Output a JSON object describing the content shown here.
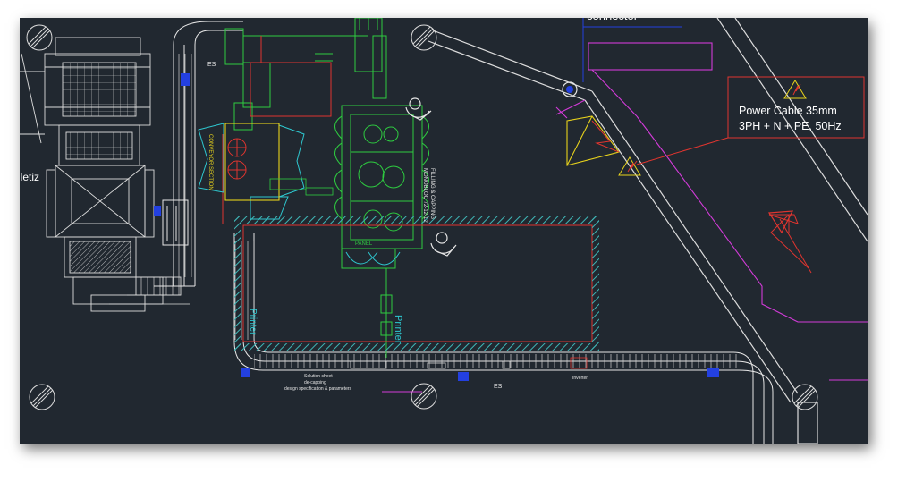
{
  "window": {
    "background": "#212830",
    "frame_shadow": true
  },
  "labels": {
    "power_cable_line1": "Power Cable 35mm",
    "power_cable_line2": "3PH + N + PE, 50Hz",
    "connector": "connector",
    "left_clipped": "lletiz",
    "printer_a": "Printer",
    "printer_b": "Printer",
    "es_top": "ES",
    "es_bottom": "ES",
    "filling_machine": "FILLING & CAPPING",
    "filling_machine_sub": "MONOBLOC 72-12-12",
    "capper_note": "CONVEYOR SECTION",
    "panel": "PANEL",
    "conveyor_note_1": "Solution sheet",
    "conveyor_note_2": "de-capping",
    "conveyor_note_3": "design specification & parameters",
    "inverter": "Inverter"
  },
  "colors": {
    "white_lines": "#e6e6e6",
    "green_lines": "#2ecc40",
    "cyan_lines": "#2ec8d0",
    "red_lines": "#e0352f",
    "magenta_lines": "#d23bd8",
    "yellow_lines": "#e7d21c",
    "blue_marks": "#2340e0",
    "hatch": "#3fb7b7"
  }
}
